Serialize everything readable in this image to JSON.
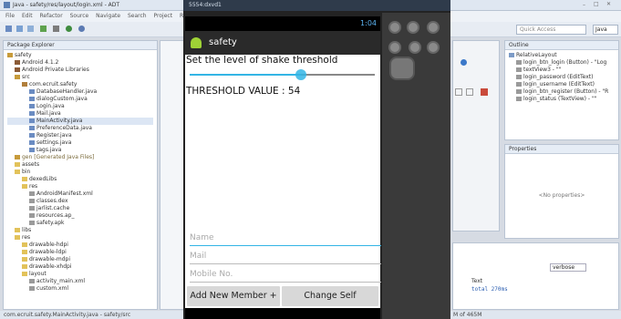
{
  "window": {
    "title": "Java - safety/res/layout/login.xml - ADT",
    "quick_access": "Quick Access",
    "java_perspective": "Java"
  },
  "menu": [
    "File",
    "Edit",
    "Refactor",
    "Source",
    "Navigate",
    "Search",
    "Project",
    "Run"
  ],
  "package_explorer": {
    "title": "Package Explorer",
    "items": [
      "safety",
      "Android 4.1.2",
      "Android Private Libraries",
      "src",
      "com.ecruit.safety",
      "DatabaseHandler.java",
      "dialogCustom.java",
      "Login.java",
      "Mail.java",
      "MainActivity.java",
      "PreferenceData.java",
      "Register.java",
      "settings.java",
      "tags.java",
      "gen [Generated Java Files]",
      "assets",
      "bin",
      "dexedLibs",
      "res",
      "AndroidManifest.xml",
      "classes.dex",
      "jarlist.cache",
      "resources.ap_",
      "safety.apk",
      "libs",
      "res",
      "drawable-hdpi",
      "drawable-ldpi",
      "drawable-mdpi",
      "drawable-xhdpi",
      "layout",
      "activity_main.xml",
      "custom.xml"
    ]
  },
  "emulator": {
    "title": "5554:dxvd1",
    "time": "1:04"
  },
  "app": {
    "name": "safety",
    "shake_label": "Set the level of shake threshold",
    "slider_fraction": 0.6,
    "threshold_label": "THRESHOLD VALUE : 54",
    "name_placeholder": "Name",
    "mail_placeholder": "Mail",
    "mobile_placeholder": "Mobile No.",
    "add_button": "Add New Member +",
    "change_button": "Change Self"
  },
  "outline": {
    "title": "Outline",
    "items": [
      "RelativeLayout",
      "login_btn_login (Button) - \"Log",
      "textView3 - \"\"",
      "login_password (EditText)",
      "login_username (EditText)",
      "login_btn_register (Button) - \"R",
      "login_status (TextView) - \"\""
    ]
  },
  "properties": {
    "title": "Properties",
    "no_props": "<No properties>"
  },
  "console": {
    "verbose": "verbose",
    "text_header": "Text",
    "row": "total 270ms"
  },
  "status": {
    "left": "com.ecruit.safety.MainActivity.java - safety/src",
    "memory": "M of 465M"
  }
}
